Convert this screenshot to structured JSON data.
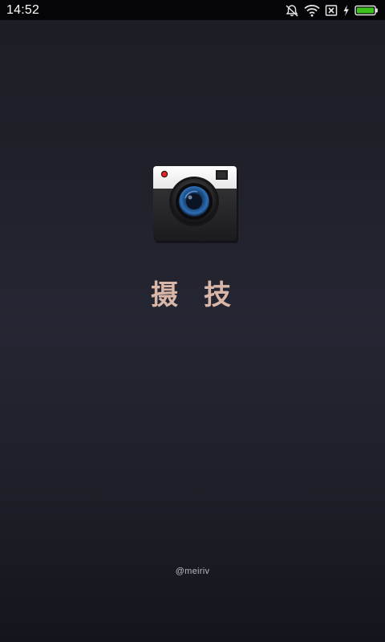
{
  "status_bar": {
    "time": "14:52",
    "icons": [
      "alarm-off-icon",
      "wifi-icon",
      "sim-disabled-icon",
      "charging-bolt-icon",
      "battery-icon"
    ],
    "battery_color": "#3bc21b"
  },
  "splash": {
    "logo_icon": "camera-icon",
    "title_char1": "摄",
    "title_char2": "技",
    "title_color": "#d9b6a8",
    "credit": "@meiriv"
  }
}
